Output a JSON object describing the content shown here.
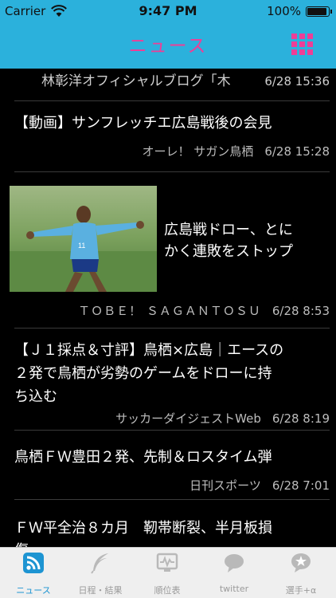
{
  "status_bar": {
    "carrier": "Carrier",
    "time": "9:47 PM",
    "battery": "100%"
  },
  "nav": {
    "title": "ニュース",
    "menu_icon": "grid-icon",
    "accent_color": "#ee3e97",
    "bar_color": "#2bb1dc"
  },
  "articles": [
    {
      "title": "林彰洋オフィシャルブログ「木",
      "source": "",
      "date": "6/28 15:36"
    },
    {
      "title": "【動画】サンフレッチエ広島戦後の会見",
      "source": "オーレ！ サガン鳥栖",
      "date": "6/28 15:28"
    },
    {
      "title_lines": [
        "広島戦ドロー、とに",
        "かく連敗をストップ"
      ],
      "source": "ＴＯＢＥ！ ＳＡＧＡＮＴＯＳＵ",
      "date": "6/28 8:53",
      "image": "soccer-player-photo"
    },
    {
      "title_lines": [
        "【Ｊ１採点＆寸評】鳥栖×広島｜エースの",
        "２発で鳥栖が劣勢のゲームをドローに持",
        "ち込む"
      ],
      "source": "サッカーダイジェストWeb",
      "date": "6/28 8:19"
    },
    {
      "title": "鳥栖ＦＷ豊田２発、先制＆ロスタイム弾",
      "source": "日刊スポーツ",
      "date": "6/28 7:01"
    },
    {
      "title_lines": [
        "ＦＷ平全治８カ月　靭帯断裂、半月板損",
        "傷"
      ],
      "source": "",
      "date": ""
    }
  ],
  "tabbar": {
    "tabs": [
      {
        "label": "ニュース",
        "icon": "rss-icon",
        "active": true
      },
      {
        "label": "日程・結果",
        "icon": "quill-icon",
        "active": false
      },
      {
        "label": "順位表",
        "icon": "chart-monitor-icon",
        "active": false
      },
      {
        "label": "twitter",
        "icon": "speech-bubble-icon",
        "active": false
      },
      {
        "label": "選手+α",
        "icon": "star-bubble-icon",
        "active": false
      }
    ]
  }
}
